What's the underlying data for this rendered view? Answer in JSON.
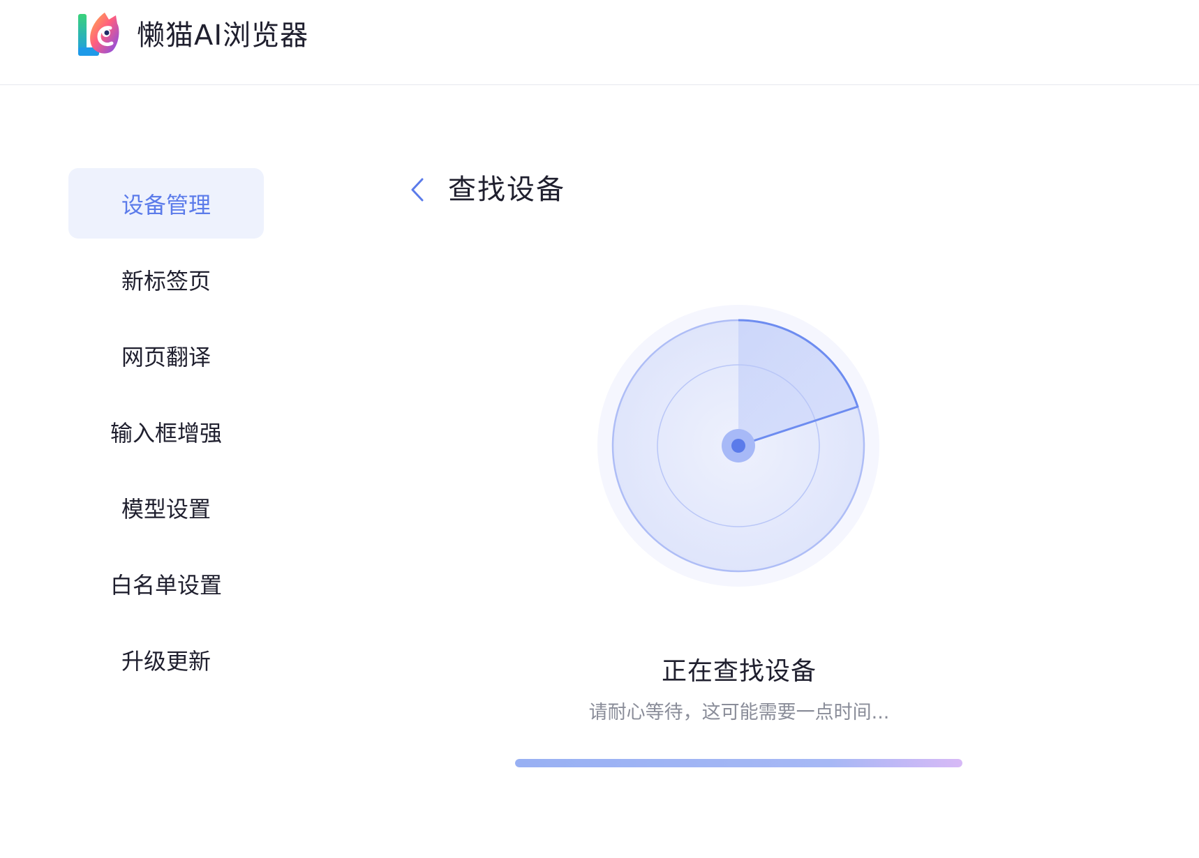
{
  "app": {
    "title": "懒猫AI浏览器",
    "logo_icon": "lazycat-logo-icon"
  },
  "sidebar": {
    "items": [
      {
        "label": "设备管理",
        "active": true
      },
      {
        "label": "新标签页"
      },
      {
        "label": "网页翻译"
      },
      {
        "label": "输入框增强"
      },
      {
        "label": "模型设置"
      },
      {
        "label": "白名单设置"
      },
      {
        "label": "升级更新"
      }
    ]
  },
  "main": {
    "back_icon": "chevron-left-icon",
    "title": "查找设备",
    "radar_icon": "radar-scan-icon",
    "status_title": "正在查找设备",
    "status_hint": "请耐心等待，这可能需要一点时间...",
    "progress": 1.0
  },
  "colors": {
    "accent": "#5b7bea",
    "active_bg": "#eef2fd",
    "text": "#1f1f2e",
    "muted": "#8a8d99",
    "radar_fill": "#dfe5fb",
    "radar_stroke": "#6d8cf0"
  }
}
